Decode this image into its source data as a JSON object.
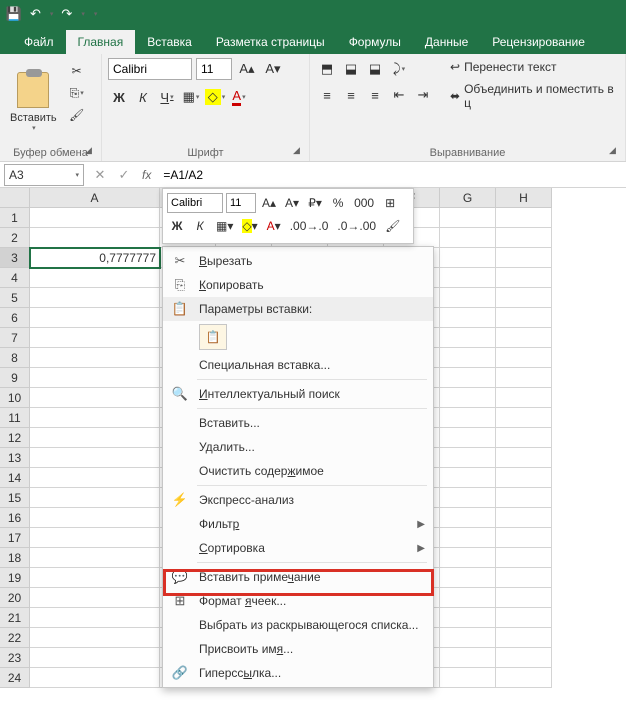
{
  "qat": {
    "save": "💾",
    "undo": "↶",
    "redo": "↷"
  },
  "tabs": {
    "file": "Файл",
    "home": "Главная",
    "insert": "Вставка",
    "layout": "Разметка страницы",
    "formulas": "Формулы",
    "data": "Данные",
    "review": "Рецензирование"
  },
  "ribbon": {
    "clipboard": {
      "label": "Буфер обмена",
      "paste": "Вставить"
    },
    "font": {
      "label": "Шрифт",
      "name": "Calibri",
      "size": "11",
      "bold": "Ж",
      "italic": "К",
      "underline": "Ч"
    },
    "alignment": {
      "label": "Выравнивание",
      "wrap": "Перенести текст",
      "merge": "Объединить и поместить в ц"
    }
  },
  "formula_bar": {
    "cell_ref": "A3",
    "formula": "=A1/A2"
  },
  "grid": {
    "cols": [
      "A",
      "B",
      "C",
      "D",
      "E",
      "F",
      "G",
      "H"
    ],
    "rows": 24,
    "cells": {
      "A3": "0,7777777"
    },
    "selected": "A3"
  },
  "mini_toolbar": {
    "font": "Calibri",
    "size": "11"
  },
  "context_menu": {
    "cut": "Вырезать",
    "copy": "Копировать",
    "paste_header": "Параметры вставки:",
    "paste_special": "Специальная вставка...",
    "smart_lookup": "Интеллектуальный поиск",
    "insert": "Вставить...",
    "delete": "Удалить...",
    "clear": "Очистить содержимое",
    "quick_analysis": "Экспресс-анализ",
    "filter": "Фильтр",
    "sort": "Сортировка",
    "insert_comment": "Вставить примечание",
    "format_cells": "Формат ячеек...",
    "pick_list": "Выбрать из раскрывающегося списка...",
    "define_name": "Присвоить имя...",
    "hyperlink": "Гиперссылка..."
  }
}
